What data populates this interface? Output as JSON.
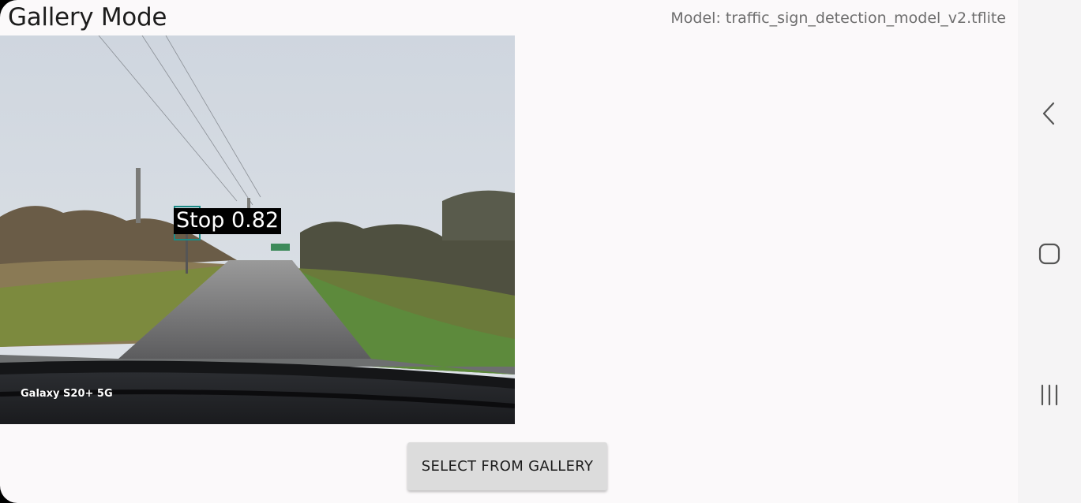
{
  "header": {
    "title": "Gallery Mode",
    "model_label": "Model: traffic_sign_detection_model_v2.tflite"
  },
  "detection": {
    "label": "Stop 0.82",
    "box_color": "#1b8a86"
  },
  "photo": {
    "watermark": "Galaxy S20+ 5G"
  },
  "actions": {
    "select_label": "SELECT FROM GALLERY"
  },
  "navbar": {
    "back_icon": "back-chevron-icon",
    "home_icon": "home-icon",
    "recents_icon": "recents-icon"
  }
}
